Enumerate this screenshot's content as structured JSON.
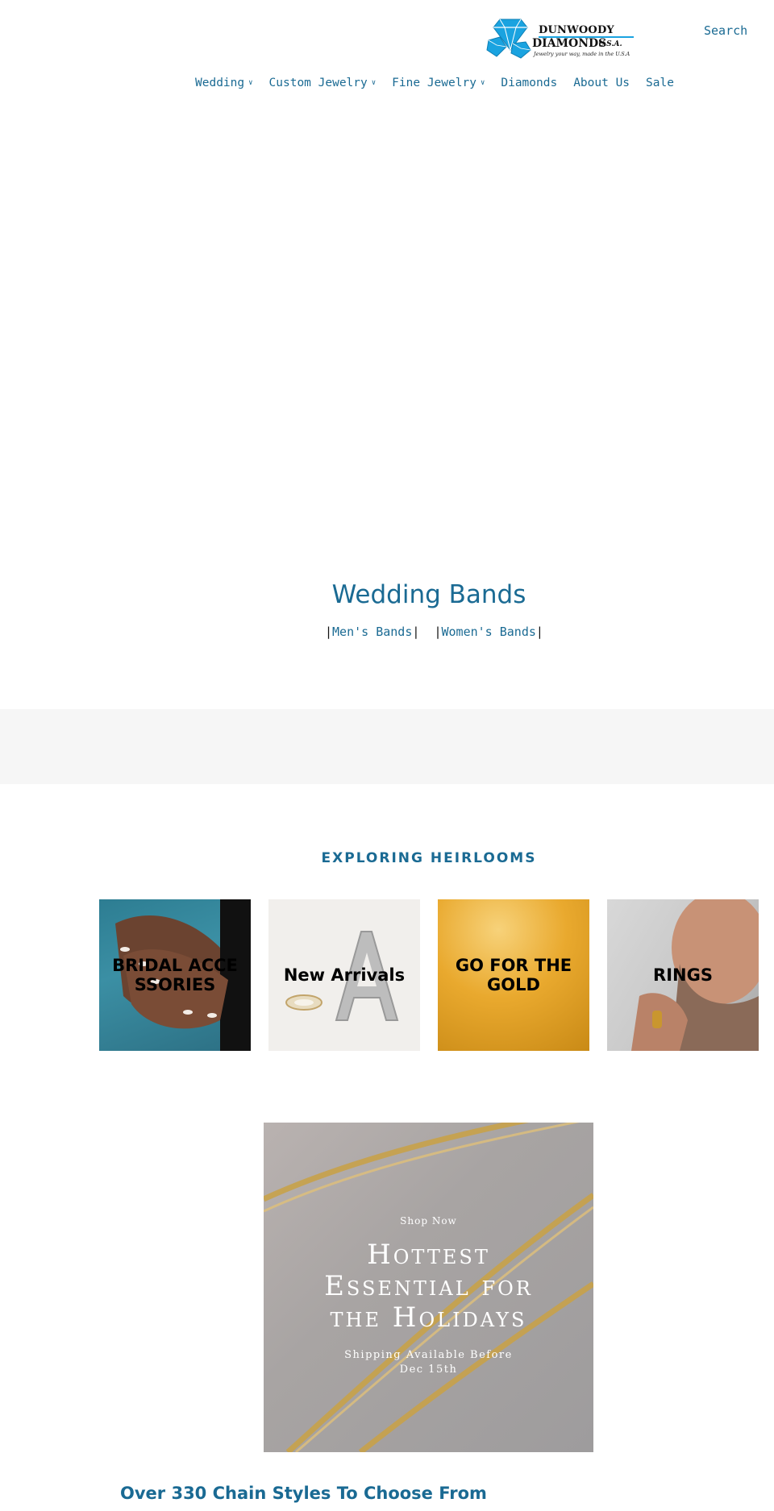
{
  "header": {
    "logo": {
      "line1": "DUNWOODY",
      "line2": "DIAMONDS",
      "suffix": "U.S.A.",
      "tagline": "Jewelry your way, made in the U.S.A",
      "brand_color": "#1aa3e0"
    },
    "search_label": "Search"
  },
  "nav": {
    "items": [
      {
        "label": "Wedding",
        "has_dropdown": true
      },
      {
        "label": "Custom Jewelry",
        "has_dropdown": true
      },
      {
        "label": "Fine Jewelry",
        "has_dropdown": true
      },
      {
        "label": "Diamonds",
        "has_dropdown": false
      },
      {
        "label": "About Us",
        "has_dropdown": false
      },
      {
        "label": "Sale",
        "has_dropdown": false
      }
    ]
  },
  "hero": {
    "title": "Wedding Bands",
    "links": [
      {
        "label": "Men's Bands"
      },
      {
        "label": "Women's Bands"
      }
    ]
  },
  "heirlooms": {
    "title": "EXPLORING HEIRLOOMS",
    "tiles": [
      {
        "label": "BRIDAL ACCESSORIES",
        "image": "hands-with-manicure"
      },
      {
        "label": "New Arrivals",
        "image": "diamond-letter-earring"
      },
      {
        "label": "GO FOR THE GOLD",
        "image": "gold-glitter"
      },
      {
        "label": "RINGS",
        "image": "man-wearing-gold-ring"
      }
    ]
  },
  "promo": {
    "shop_now": "Shop Now",
    "headline_line1": "Hottest",
    "headline_line2": "Essential for",
    "headline_line3": "the Holidays",
    "shipping_line1": "Shipping Available Before",
    "shipping_line2": "Dec 15th",
    "image": "gold-chains"
  },
  "chains": {
    "heading": "Over 330 Chain Styles To Choose From"
  },
  "colors": {
    "link_blue": "#1a6a93",
    "band_grey": "#f6f6f6"
  }
}
